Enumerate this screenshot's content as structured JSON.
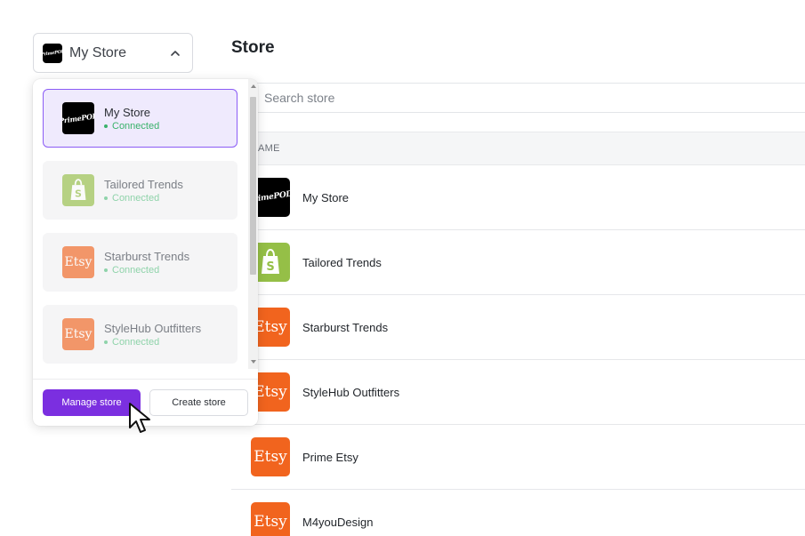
{
  "switcher": {
    "current_store": "My Store",
    "logo_text": "PrimePOD"
  },
  "page": {
    "title": "Store"
  },
  "search": {
    "placeholder": "Search store"
  },
  "table": {
    "header_name": "AME",
    "rows": [
      {
        "name": "My Store",
        "logo": "primepod-logo",
        "logo_text": "PrimePOD"
      },
      {
        "name": "Tailored Trends",
        "logo": "shopify-icon"
      },
      {
        "name": "Starburst Trends",
        "logo": "etsy-logo",
        "logo_text": "Etsy"
      },
      {
        "name": "StyleHub Outfitters",
        "logo": "etsy-logo",
        "logo_text": "Etsy"
      },
      {
        "name": "Prime Etsy",
        "logo": "etsy-logo",
        "logo_text": "Etsy"
      },
      {
        "name": "M4youDesign",
        "logo": "etsy-logo",
        "logo_text": "Etsy"
      }
    ]
  },
  "dropdown": {
    "options": [
      {
        "name": "My Store",
        "status": "Connected",
        "logo": "primepod-logo",
        "logo_text": "PrimePOD",
        "selected": true
      },
      {
        "name": "Tailored Trends",
        "status": "Connected",
        "logo": "shopify-icon",
        "selected": false
      },
      {
        "name": "Starburst Trends",
        "status": "Connected",
        "logo": "etsy-logo",
        "logo_text": "Etsy",
        "selected": false
      },
      {
        "name": "StyleHub Outfitters",
        "status": "Connected",
        "logo": "etsy-logo",
        "logo_text": "Etsy",
        "selected": false
      }
    ],
    "manage_label": "Manage store",
    "create_label": "Create store"
  },
  "colors": {
    "accent": "#7b2fe0",
    "selected_bg": "#efeafd",
    "selected_border": "#8b5cf6",
    "connected": "#3ab26b",
    "shopify": "#95bf47",
    "etsy": "#f1641e"
  }
}
